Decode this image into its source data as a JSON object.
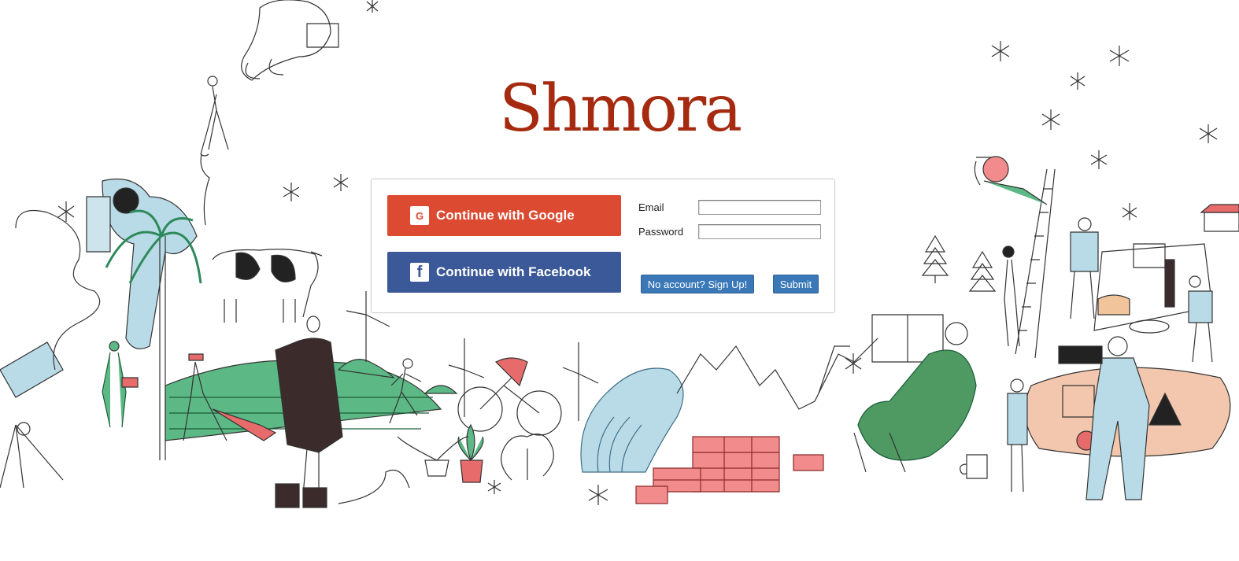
{
  "brand": {
    "name": "Shmora",
    "color": "#a52a0f"
  },
  "login": {
    "google_label": "Continue with Google",
    "google_icon": "google-g-icon",
    "google_color": "#dc4a31",
    "facebook_label": "Continue with Facebook",
    "facebook_icon": "facebook-f-icon",
    "facebook_color": "#3b5998",
    "email_label": "Email",
    "email_value": "",
    "password_label": "Password",
    "password_value": "",
    "signup_label": "No account? Sign Up!",
    "submit_label": "Submit",
    "button_color": "#3a78b8"
  },
  "background": {
    "description_icon": "hand-drawn-illustration-panorama"
  }
}
